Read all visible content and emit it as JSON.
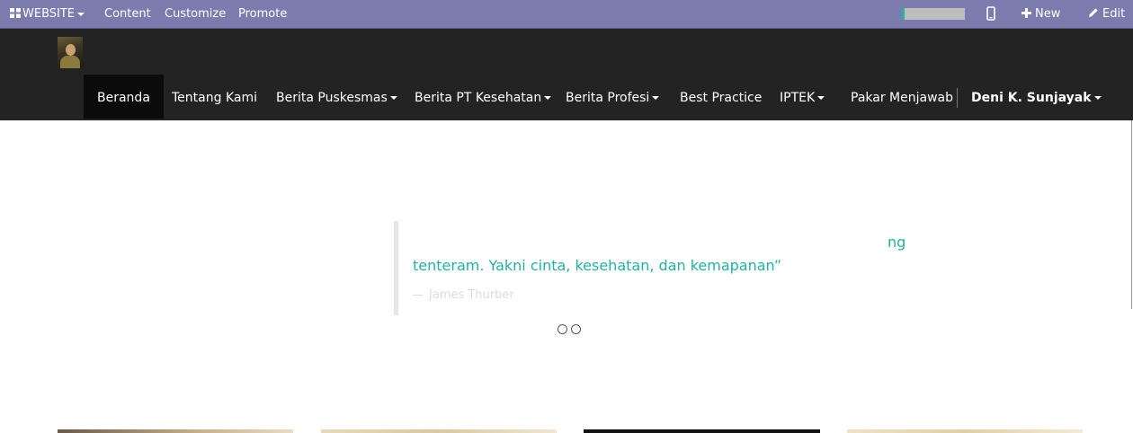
{
  "admin_bar": {
    "website_label": "WEBSITE",
    "content_label": "Content",
    "customize_label": "Customize",
    "promote_label": "Promote",
    "progress_fraction": 0.04,
    "new_label": "New",
    "edit_label": "Edit",
    "icons": [
      "grid-icon",
      "mobile-icon",
      "plus-icon",
      "pencil-icon"
    ]
  },
  "navbar": {
    "items": [
      {
        "label": "Beranda",
        "active": true
      },
      {
        "label": "Tentang Kami"
      },
      {
        "label": "Berita Puskesmas",
        "dropdown": true
      },
      {
        "label": "Berita PT Kesehatan",
        "dropdown": true
      },
      {
        "label": "Berita Profesi",
        "dropdown": true
      },
      {
        "label": "Best Practice"
      },
      {
        "label": "IPTEK",
        "dropdown": true
      },
      {
        "label": "Pakar Menjawab"
      }
    ],
    "user_name": "Deni K. Sunjayak"
  },
  "quote": {
    "line1_partial": "ng",
    "line2": "tenteram. Yakni cinta, kesehatan, dan kemapanan”",
    "author": "James Thurber"
  },
  "colors": {
    "admin_bar": "#7c7bad",
    "navbar": "#232323",
    "accent": "#21b2a0"
  }
}
